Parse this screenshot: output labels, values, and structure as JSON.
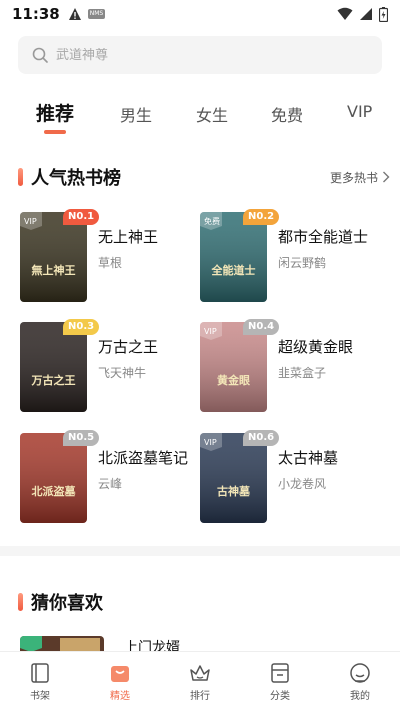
{
  "status_bar": {
    "time": "11:38",
    "nms_label": "NMS"
  },
  "search": {
    "placeholder": "武道神尊"
  },
  "tabs": [
    {
      "label": "推荐",
      "active": true
    },
    {
      "label": "男生"
    },
    {
      "label": "女生"
    },
    {
      "label": "免费"
    },
    {
      "label": "VIP"
    }
  ],
  "hot_section": {
    "title": "人气热书榜",
    "more_label": "更多热书",
    "books": [
      {
        "rank": "N0.1",
        "title": "无上神王",
        "author": "草根",
        "cover_color": "#3a3420",
        "cover_tag": "VIP",
        "cover_text": "無上神王"
      },
      {
        "rank": "N0.2",
        "title": "都市全能道士",
        "author": "闲云野鹤",
        "cover_color": "#2f6e73",
        "cover_tag": "免费",
        "cover_text": "全能道士"
      },
      {
        "rank": "N0.3",
        "title": "万古之王",
        "author": "飞天神牛",
        "cover_color": "#2a2220",
        "cover_tag": "",
        "cover_text": "万古之王"
      },
      {
        "rank": "N0.4",
        "title": "超级黄金眼",
        "author": "韭菜盒子",
        "cover_color": "#c98a8a",
        "cover_tag": "VIP",
        "cover_text": "黄金眼"
      },
      {
        "rank": "N0.5",
        "title": "北派盗墓笔记",
        "author": "云峰",
        "cover_color": "#a6382a",
        "cover_tag": "",
        "cover_text": "北派盗墓"
      },
      {
        "rank": "N0.6",
        "title": "太古神墓",
        "author": "小龙卷风",
        "cover_color": "#2a3a55",
        "cover_tag": "VIP",
        "cover_text": "古神墓"
      }
    ]
  },
  "guess_section": {
    "title": "猜你喜欢",
    "first_item_title": "上门龙婿"
  },
  "bottom_nav": [
    {
      "label": "书架",
      "icon": "bookshelf-icon"
    },
    {
      "label": "精选",
      "icon": "featured-bag-icon",
      "active": true
    },
    {
      "label": "排行",
      "icon": "crown-icon"
    },
    {
      "label": "分类",
      "icon": "category-icon"
    },
    {
      "label": "我的",
      "icon": "profile-icon"
    }
  ],
  "colors": {
    "accent": "#f06a4a",
    "rank1": "#f05a3f",
    "rank2": "#f3a43b",
    "rank3": "#f3c94a",
    "rank_other": "#b5b5b5"
  }
}
